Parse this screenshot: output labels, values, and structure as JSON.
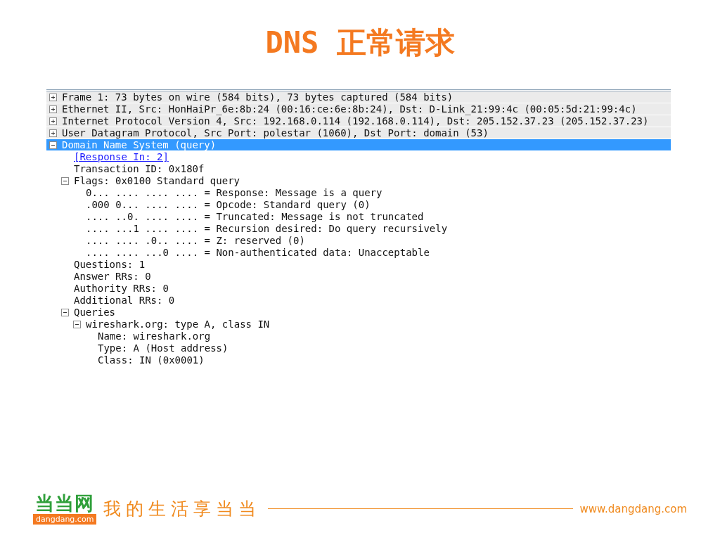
{
  "slide_title": "DNS 正常请求",
  "tree": [
    {
      "label": "Frame 1: 73 bytes on wire (584 bits), 73 bytes captured (584 bits)",
      "expanded": false,
      "selected": false
    },
    {
      "label": "Ethernet II, Src: HonHaiPr_6e:8b:24 (00:16:ce:6e:8b:24), Dst: D-Link_21:99:4c (00:05:5d:21:99:4c)",
      "expanded": false,
      "selected": false
    },
    {
      "label": "Internet Protocol Version 4, Src: 192.168.0.114 (192.168.0.114), Dst: 205.152.37.23 (205.152.37.23)",
      "expanded": false,
      "selected": false
    },
    {
      "label": "User Datagram Protocol, Src Port: polestar (1060), Dst Port: domain (53)",
      "expanded": false,
      "selected": false
    },
    {
      "label": "Domain Name System (query)",
      "expanded": true,
      "selected": true,
      "children": [
        {
          "label": "[Response In: 2]",
          "kind": "link"
        },
        {
          "label": "Transaction ID: 0x180f",
          "kind": "text"
        },
        {
          "label": "Flags: 0x0100 Standard query",
          "kind": "text",
          "expanded": true,
          "children": [
            {
              "label": "0... .... .... .... = Response: Message is a query"
            },
            {
              "label": ".000 0... .... .... = Opcode: Standard query (0)"
            },
            {
              "label": ".... ..0. .... .... = Truncated: Message is not truncated"
            },
            {
              "label": ".... ...1 .... .... = Recursion desired: Do query recursively"
            },
            {
              "label": ".... .... .0.. .... = Z: reserved (0)"
            },
            {
              "label": ".... .... ...0 .... = Non-authenticated data: Unacceptable"
            }
          ]
        },
        {
          "label": "Questions: 1",
          "kind": "text"
        },
        {
          "label": "Answer RRs: 0",
          "kind": "text"
        },
        {
          "label": "Authority RRs: 0",
          "kind": "text"
        },
        {
          "label": "Additional RRs: 0",
          "kind": "text"
        },
        {
          "label": "Queries",
          "kind": "text",
          "expanded": true,
          "children": [
            {
              "label": "wireshark.org: type A, class IN",
              "expanded": true,
              "children": [
                {
                  "label": "Name: wireshark.org"
                },
                {
                  "label": "Type: A (Host address)"
                },
                {
                  "label": "Class: IN (0x0001)"
                }
              ]
            }
          ]
        }
      ]
    }
  ],
  "footer": {
    "logo": "当当网",
    "logo_domain": "dangdang.com",
    "slogan": "我的生活享当当",
    "url": "www.dangdang.com"
  }
}
